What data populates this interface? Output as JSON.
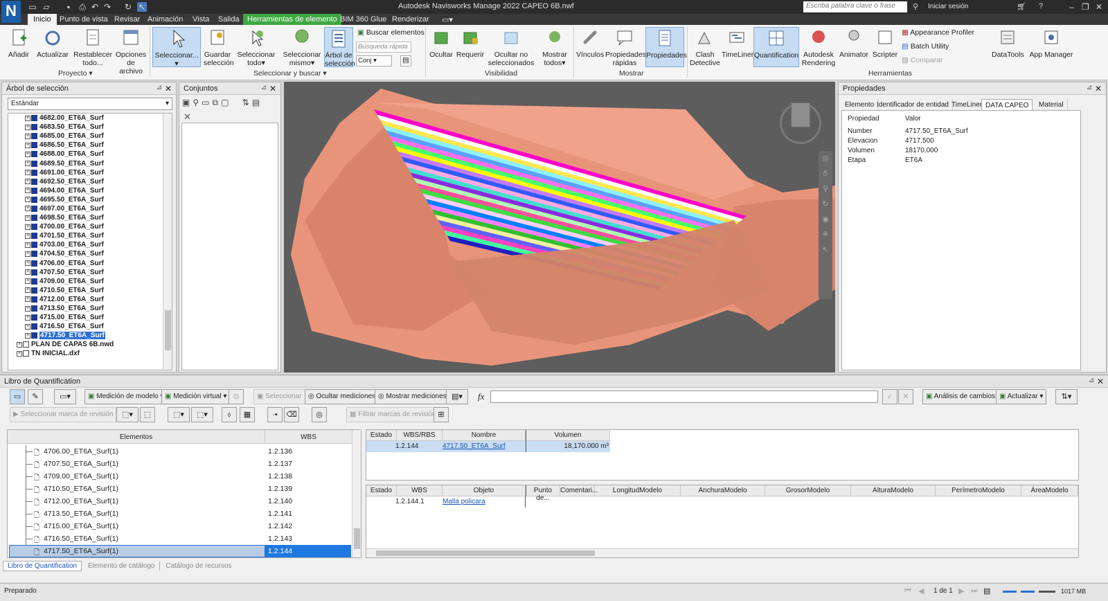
{
  "app": {
    "window_title": "Autodesk Navisworks Manage 2022    CAPEO 6B.nwf",
    "search_placeholder": "Escriba palabra clave o frase",
    "signin_label": "Iniciar sesión",
    "logo_letter": "N"
  },
  "menu": {
    "items": [
      "Inicio",
      "Punto de vista",
      "Revisar",
      "Animación",
      "Vista",
      "Salida",
      "Herramientas de elemento",
      "BIM 360 Glue",
      "Renderizar"
    ]
  },
  "ribbon": {
    "proyecto": {
      "buttons": [
        "Añadir",
        "Actualizar",
        "Restablecer todo...",
        "Opciones de archivo"
      ],
      "group_label": "Proyecto"
    },
    "seleccionar": {
      "buttons": [
        "Seleccionar...",
        "Guardar selección",
        "Seleccionar todo",
        "Seleccionar mismo",
        "Árbol de selección"
      ],
      "buscar_elementos": "Buscar elementos",
      "busqueda_rapida": "Búsqueda rápida",
      "conj": "Conj",
      "group_label": "Seleccionar y buscar"
    },
    "visibilidad": {
      "buttons": [
        "Ocultar",
        "Requerir",
        "Ocultar no seleccionados",
        "Mostrar todos"
      ],
      "group_label": "Visibilidad"
    },
    "mostrar": {
      "buttons": [
        "Vínculos",
        "Propiedades rápidas",
        "Propiedades"
      ],
      "group_label": "Mostrar"
    },
    "herramientas": {
      "buttons": [
        "Clash Detective",
        "TimeLiner",
        "Quantification",
        "Autodesk Rendering",
        "Animator",
        "Scripter"
      ],
      "small": [
        "Appearance Profiler",
        "Batch Utility",
        "Comparar"
      ],
      "extra": [
        "DataTools",
        "App Manager"
      ],
      "group_label": "Herramientas"
    }
  },
  "selection_tree": {
    "title": "Árbol de selección",
    "dropdown": "Estándar",
    "items": [
      "4682.00_ET6A_Surf",
      "4683.50_ET6A_Surf",
      "4685.00_ET6A_Surf",
      "4686.50_ET6A_Surf",
      "4688.00_ET6A_Surf",
      "4689.50_ET6A_Surf",
      "4691.00_ET6A_Surf",
      "4692.50_ET6A_Surf",
      "4694.00_ET6A_Surf",
      "4695.50_ET6A_Surf",
      "4697.00_ET6A_Surf",
      "4698.50_ET6A_Surf",
      "4700.00_ET6A_Surf",
      "4701.50_ET6A_Surf",
      "4703.00_ET6A_Surf",
      "4704.50_ET6A_Surf",
      "4706.00_ET6A_Surf",
      "4707.50_ET6A_Surf",
      "4709.00_ET6A_Surf",
      "4710.50_ET6A_Surf",
      "4712.00_ET6A_Surf",
      "4713.50_ET6A_Surf",
      "4715.00_ET6A_Surf",
      "4716.50_ET6A_Surf",
      "4717.50_ET6A_Surf"
    ],
    "selected_index": 24,
    "roots": [
      "PLAN DE CAPAS 6B.nwd",
      "TN INICIAL.dxf"
    ]
  },
  "sets": {
    "title": "Conjuntos"
  },
  "properties": {
    "title": "Propiedades",
    "tabs": [
      "Elemento",
      "Identificador de entidad",
      "TimeLiner",
      "DATA CAPEO",
      "Material"
    ],
    "active_tab": "DATA CAPEO",
    "col_prop": "Propiedad",
    "col_val": "Valor",
    "rows": [
      {
        "k": "Number",
        "v": "4717.50_ET6A_Surf"
      },
      {
        "k": "Elevacion",
        "v": "4717.500"
      },
      {
        "k": "Volumen",
        "v": "18170.000"
      },
      {
        "k": "Etapa",
        "v": "ET6A"
      }
    ]
  },
  "quant": {
    "title": "Libro de Quantification",
    "medicion_modelo": "Medición de modelo",
    "medicion_virtual": "Medición virtual",
    "seleccionar": "Seleccionar",
    "ocultar_mediciones": "Ocultar mediciones",
    "mostrar_mediciones": "Mostrar mediciones",
    "analisis_cambios": "Análisis de cambios",
    "actualizar": "Actualizar",
    "sel_marca": "Seleccionar marca de revisión",
    "filtrar_marcas": "Filtrar marcas de revisión",
    "fx": "fx",
    "col_elementos": "Elementos",
    "col_wbs": "WBS",
    "rows": [
      {
        "name": "4706.00_ET6A_Surf(1)",
        "wbs": "1.2.136"
      },
      {
        "name": "4707.50_ET6A_Surf(1)",
        "wbs": "1.2.137"
      },
      {
        "name": "4709.00_ET6A_Surf(1)",
        "wbs": "1.2.138"
      },
      {
        "name": "4710.50_ET6A_Surf(1)",
        "wbs": "1.2.139"
      },
      {
        "name": "4712.00_ET6A_Surf(1)",
        "wbs": "1.2.140"
      },
      {
        "name": "4713.50_ET6A_Surf(1)",
        "wbs": "1.2.141"
      },
      {
        "name": "4715.00_ET6A_Surf(1)",
        "wbs": "1.2.142"
      },
      {
        "name": "4716.50_ET6A_Surf(1)",
        "wbs": "1.2.143"
      },
      {
        "name": "4717.50_ET6A_Surf(1)",
        "wbs": "1.2.144"
      }
    ],
    "top_headers": [
      "Estado",
      "WBS/RBS",
      "Nombre",
      "Volumen"
    ],
    "top_row": {
      "wbs": "1.2.144",
      "name": "4717.50_ET6A_Surf",
      "volume": "18,170.000 m³"
    },
    "bottom_headers": [
      "Estado",
      "WBS",
      "Objeto",
      "Punto de...",
      "Comentari...",
      "LongitudModelo",
      "AnchuraModelo",
      "GrosorModelo",
      "AlturaModelo",
      "PerímetroModelo",
      "ÁreaModelo"
    ],
    "bottom_row": {
      "wbs": "1.2.144.1",
      "obj": "Malla policara"
    },
    "tabs": [
      "Libro de Quantification",
      "Elemento de catálogo",
      "Catálogo de recursos"
    ]
  },
  "status": {
    "text": "Preparado",
    "page": "1 de 1",
    "memory": "1017 MB"
  }
}
